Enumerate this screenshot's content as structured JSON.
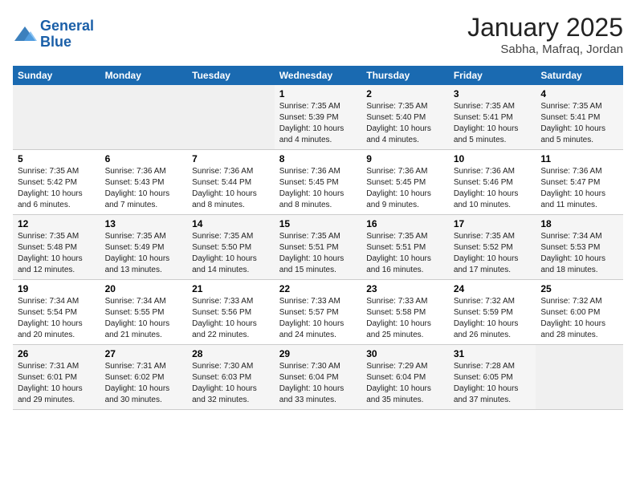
{
  "header": {
    "logo_line1": "General",
    "logo_line2": "Blue",
    "month": "January 2025",
    "location": "Sabha, Mafraq, Jordan"
  },
  "weekdays": [
    "Sunday",
    "Monday",
    "Tuesday",
    "Wednesday",
    "Thursday",
    "Friday",
    "Saturday"
  ],
  "weeks": [
    [
      {
        "day": "",
        "sunrise": "",
        "sunset": "",
        "daylight": ""
      },
      {
        "day": "",
        "sunrise": "",
        "sunset": "",
        "daylight": ""
      },
      {
        "day": "",
        "sunrise": "",
        "sunset": "",
        "daylight": ""
      },
      {
        "day": "1",
        "sunrise": "Sunrise: 7:35 AM",
        "sunset": "Sunset: 5:39 PM",
        "daylight": "Daylight: 10 hours and 4 minutes."
      },
      {
        "day": "2",
        "sunrise": "Sunrise: 7:35 AM",
        "sunset": "Sunset: 5:40 PM",
        "daylight": "Daylight: 10 hours and 4 minutes."
      },
      {
        "day": "3",
        "sunrise": "Sunrise: 7:35 AM",
        "sunset": "Sunset: 5:41 PM",
        "daylight": "Daylight: 10 hours and 5 minutes."
      },
      {
        "day": "4",
        "sunrise": "Sunrise: 7:35 AM",
        "sunset": "Sunset: 5:41 PM",
        "daylight": "Daylight: 10 hours and 5 minutes."
      }
    ],
    [
      {
        "day": "5",
        "sunrise": "Sunrise: 7:35 AM",
        "sunset": "Sunset: 5:42 PM",
        "daylight": "Daylight: 10 hours and 6 minutes."
      },
      {
        "day": "6",
        "sunrise": "Sunrise: 7:36 AM",
        "sunset": "Sunset: 5:43 PM",
        "daylight": "Daylight: 10 hours and 7 minutes."
      },
      {
        "day": "7",
        "sunrise": "Sunrise: 7:36 AM",
        "sunset": "Sunset: 5:44 PM",
        "daylight": "Daylight: 10 hours and 8 minutes."
      },
      {
        "day": "8",
        "sunrise": "Sunrise: 7:36 AM",
        "sunset": "Sunset: 5:45 PM",
        "daylight": "Daylight: 10 hours and 8 minutes."
      },
      {
        "day": "9",
        "sunrise": "Sunrise: 7:36 AM",
        "sunset": "Sunset: 5:45 PM",
        "daylight": "Daylight: 10 hours and 9 minutes."
      },
      {
        "day": "10",
        "sunrise": "Sunrise: 7:36 AM",
        "sunset": "Sunset: 5:46 PM",
        "daylight": "Daylight: 10 hours and 10 minutes."
      },
      {
        "day": "11",
        "sunrise": "Sunrise: 7:36 AM",
        "sunset": "Sunset: 5:47 PM",
        "daylight": "Daylight: 10 hours and 11 minutes."
      }
    ],
    [
      {
        "day": "12",
        "sunrise": "Sunrise: 7:35 AM",
        "sunset": "Sunset: 5:48 PM",
        "daylight": "Daylight: 10 hours and 12 minutes."
      },
      {
        "day": "13",
        "sunrise": "Sunrise: 7:35 AM",
        "sunset": "Sunset: 5:49 PM",
        "daylight": "Daylight: 10 hours and 13 minutes."
      },
      {
        "day": "14",
        "sunrise": "Sunrise: 7:35 AM",
        "sunset": "Sunset: 5:50 PM",
        "daylight": "Daylight: 10 hours and 14 minutes."
      },
      {
        "day": "15",
        "sunrise": "Sunrise: 7:35 AM",
        "sunset": "Sunset: 5:51 PM",
        "daylight": "Daylight: 10 hours and 15 minutes."
      },
      {
        "day": "16",
        "sunrise": "Sunrise: 7:35 AM",
        "sunset": "Sunset: 5:51 PM",
        "daylight": "Daylight: 10 hours and 16 minutes."
      },
      {
        "day": "17",
        "sunrise": "Sunrise: 7:35 AM",
        "sunset": "Sunset: 5:52 PM",
        "daylight": "Daylight: 10 hours and 17 minutes."
      },
      {
        "day": "18",
        "sunrise": "Sunrise: 7:34 AM",
        "sunset": "Sunset: 5:53 PM",
        "daylight": "Daylight: 10 hours and 18 minutes."
      }
    ],
    [
      {
        "day": "19",
        "sunrise": "Sunrise: 7:34 AM",
        "sunset": "Sunset: 5:54 PM",
        "daylight": "Daylight: 10 hours and 20 minutes."
      },
      {
        "day": "20",
        "sunrise": "Sunrise: 7:34 AM",
        "sunset": "Sunset: 5:55 PM",
        "daylight": "Daylight: 10 hours and 21 minutes."
      },
      {
        "day": "21",
        "sunrise": "Sunrise: 7:33 AM",
        "sunset": "Sunset: 5:56 PM",
        "daylight": "Daylight: 10 hours and 22 minutes."
      },
      {
        "day": "22",
        "sunrise": "Sunrise: 7:33 AM",
        "sunset": "Sunset: 5:57 PM",
        "daylight": "Daylight: 10 hours and 24 minutes."
      },
      {
        "day": "23",
        "sunrise": "Sunrise: 7:33 AM",
        "sunset": "Sunset: 5:58 PM",
        "daylight": "Daylight: 10 hours and 25 minutes."
      },
      {
        "day": "24",
        "sunrise": "Sunrise: 7:32 AM",
        "sunset": "Sunset: 5:59 PM",
        "daylight": "Daylight: 10 hours and 26 minutes."
      },
      {
        "day": "25",
        "sunrise": "Sunrise: 7:32 AM",
        "sunset": "Sunset: 6:00 PM",
        "daylight": "Daylight: 10 hours and 28 minutes."
      }
    ],
    [
      {
        "day": "26",
        "sunrise": "Sunrise: 7:31 AM",
        "sunset": "Sunset: 6:01 PM",
        "daylight": "Daylight: 10 hours and 29 minutes."
      },
      {
        "day": "27",
        "sunrise": "Sunrise: 7:31 AM",
        "sunset": "Sunset: 6:02 PM",
        "daylight": "Daylight: 10 hours and 30 minutes."
      },
      {
        "day": "28",
        "sunrise": "Sunrise: 7:30 AM",
        "sunset": "Sunset: 6:03 PM",
        "daylight": "Daylight: 10 hours and 32 minutes."
      },
      {
        "day": "29",
        "sunrise": "Sunrise: 7:30 AM",
        "sunset": "Sunset: 6:04 PM",
        "daylight": "Daylight: 10 hours and 33 minutes."
      },
      {
        "day": "30",
        "sunrise": "Sunrise: 7:29 AM",
        "sunset": "Sunset: 6:04 PM",
        "daylight": "Daylight: 10 hours and 35 minutes."
      },
      {
        "day": "31",
        "sunrise": "Sunrise: 7:28 AM",
        "sunset": "Sunset: 6:05 PM",
        "daylight": "Daylight: 10 hours and 37 minutes."
      },
      {
        "day": "",
        "sunrise": "",
        "sunset": "",
        "daylight": ""
      }
    ]
  ]
}
